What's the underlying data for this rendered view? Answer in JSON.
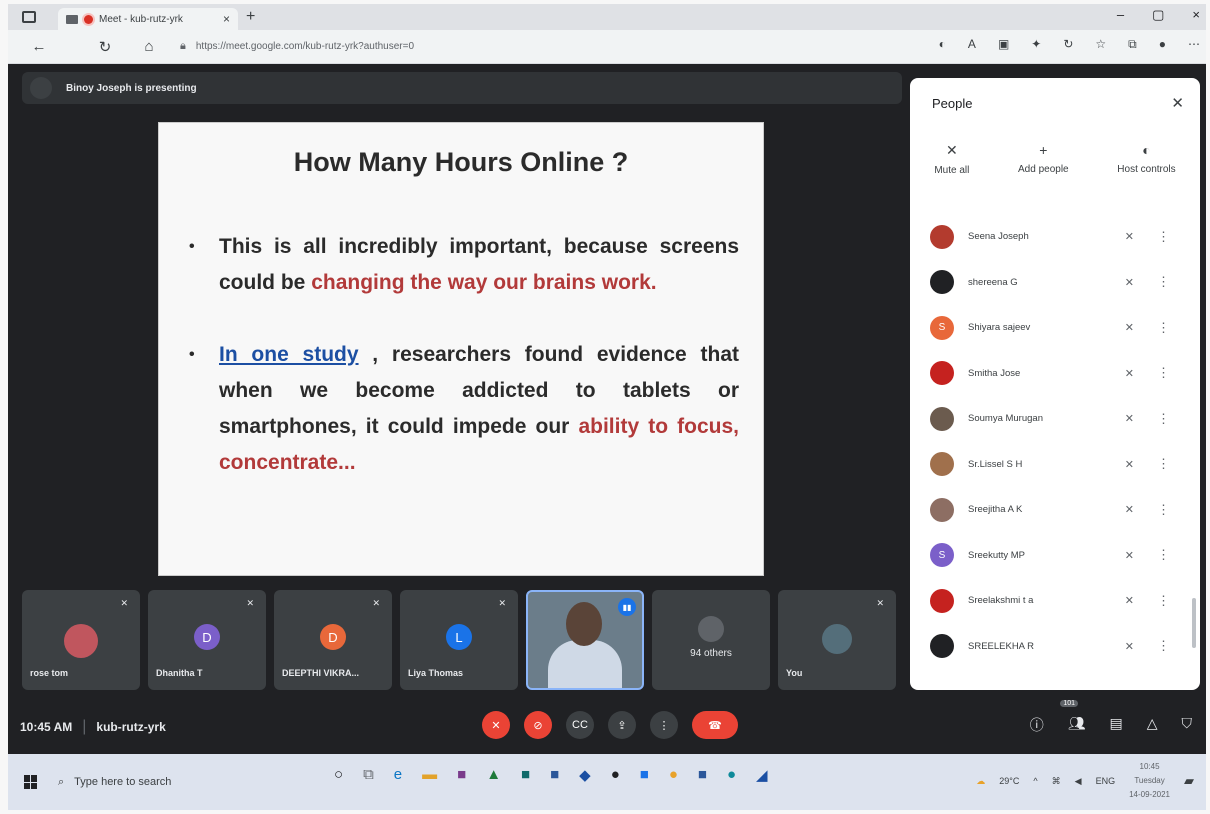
{
  "browser": {
    "tab_title": "Meet - kub-rutz-yrk",
    "tab_close": "×",
    "new_tab": "+",
    "url": "https://meet.google.com/kub-rutz-yrk?authuser=0",
    "win_min": "–",
    "win_max": "▢",
    "win_close": "×"
  },
  "meet": {
    "presenting_text": "Binoy Joseph is presenting",
    "slide": {
      "title": "How Many Hours Online ?",
      "bullet1_a": "This is all incredibly important, because screens could be ",
      "bullet1_red": "changing the way our brains work.",
      "bullet2_link": "In one study",
      "bullet2_a": " , researchers found evidence that when we become addicted to tablets or smartphones, it could impede our ",
      "bullet2_red": "ability to focus, concentrate..."
    },
    "tiles": [
      {
        "name": "rose tom",
        "initial": "",
        "color": "#c0565e"
      },
      {
        "name": "Dhanitha T",
        "initial": "D",
        "color": "#7b5fc9"
      },
      {
        "name": "DEEPTHI VIKRA...",
        "initial": "D",
        "color": "#e8683a"
      },
      {
        "name": "Liya Thomas",
        "initial": "L",
        "color": "#1a73e8"
      },
      {
        "name": "",
        "initial": "",
        "color": ""
      },
      {
        "name": "94 others",
        "initial": "",
        "color": "#5f6368"
      },
      {
        "name": "You",
        "initial": "",
        "color": "#3c4043"
      }
    ],
    "time": "10:45 AM",
    "meeting_code": "kub-rutz-yrk",
    "participant_count": "101"
  },
  "people_panel": {
    "title": "People",
    "actions": {
      "mute_all": "Mute all",
      "add_people": "Add people",
      "host_controls": "Host controls"
    },
    "participants": [
      {
        "name": "Seena Joseph",
        "initial": "",
        "color": "#b33b2e"
      },
      {
        "name": "shereena G",
        "initial": "",
        "color": "#202124"
      },
      {
        "name": "Shiyara sajeev",
        "initial": "S",
        "color": "#e8683a"
      },
      {
        "name": "Smitha Jose",
        "initial": "",
        "color": "#c5221f"
      },
      {
        "name": "Soumya Murugan",
        "initial": "",
        "color": "#6b5b4e"
      },
      {
        "name": "Sr.Lissel S H",
        "initial": "",
        "color": "#a0704c"
      },
      {
        "name": "Sreejitha A K",
        "initial": "",
        "color": "#8d6e63"
      },
      {
        "name": "Sreekutty MP",
        "initial": "S",
        "color": "#7b5fc9"
      },
      {
        "name": "Sreelakshmi t a",
        "initial": "",
        "color": "#c5221f"
      },
      {
        "name": "SREELEKHA R",
        "initial": "",
        "color": "#202124"
      }
    ]
  },
  "taskbar": {
    "search_placeholder": "Type here to search",
    "weather": "29°C",
    "lang": "ENG",
    "clock_time": "10:45",
    "clock_day": "Tuesday",
    "clock_date": "14-09-2021"
  }
}
